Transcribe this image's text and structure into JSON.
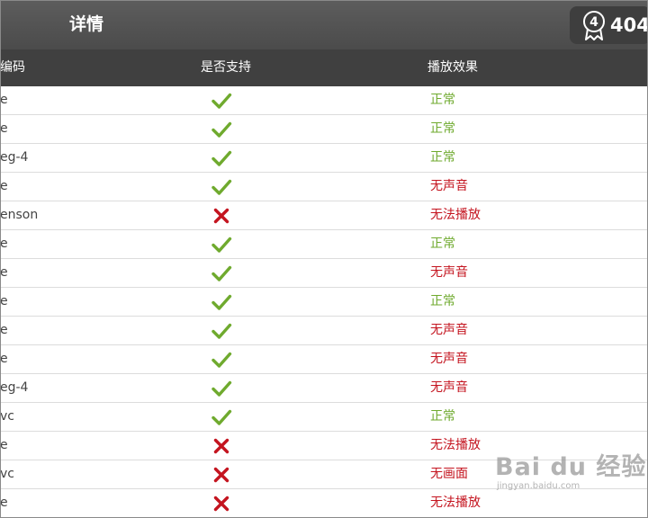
{
  "header": {
    "title": "详情",
    "badge_number": "4",
    "badge_count": "404"
  },
  "table": {
    "columns": {
      "codec": "编码",
      "support": "是否支持",
      "effect": "播放效果"
    },
    "rows": [
      {
        "codec": "e",
        "supported": true,
        "effect": "正常",
        "status": "ok"
      },
      {
        "codec": "e",
        "supported": true,
        "effect": "正常",
        "status": "ok"
      },
      {
        "codec": "eg-4",
        "supported": true,
        "effect": "正常",
        "status": "ok"
      },
      {
        "codec": "e",
        "supported": true,
        "effect": "无声音",
        "status": "bad"
      },
      {
        "codec": "enson",
        "supported": false,
        "effect": "无法播放",
        "status": "bad"
      },
      {
        "codec": "e",
        "supported": true,
        "effect": "正常",
        "status": "ok"
      },
      {
        "codec": "e",
        "supported": true,
        "effect": "无声音",
        "status": "bad"
      },
      {
        "codec": "e",
        "supported": true,
        "effect": "正常",
        "status": "ok"
      },
      {
        "codec": "e",
        "supported": true,
        "effect": "无声音",
        "status": "bad"
      },
      {
        "codec": "e",
        "supported": true,
        "effect": "无声音",
        "status": "bad"
      },
      {
        "codec": "eg-4",
        "supported": true,
        "effect": "无声音",
        "status": "bad"
      },
      {
        "codec": "vc",
        "supported": true,
        "effect": "正常",
        "status": "ok"
      },
      {
        "codec": "e",
        "supported": false,
        "effect": "无法播放",
        "status": "bad"
      },
      {
        "codec": "vc",
        "supported": false,
        "effect": "无画面",
        "status": "bad"
      },
      {
        "codec": "e",
        "supported": false,
        "effect": "无法播放",
        "status": "bad"
      }
    ]
  },
  "watermark": {
    "main": "Bai du 经验",
    "sub": "jingyan.baidu.com"
  },
  "colors": {
    "ok": "#6faa2e",
    "bad": "#c4141f",
    "header_bg": "#555555",
    "table_header_bg": "#404040"
  },
  "icons": {
    "supported": "check-icon",
    "unsupported": "cross-icon",
    "badge": "medal-icon"
  }
}
